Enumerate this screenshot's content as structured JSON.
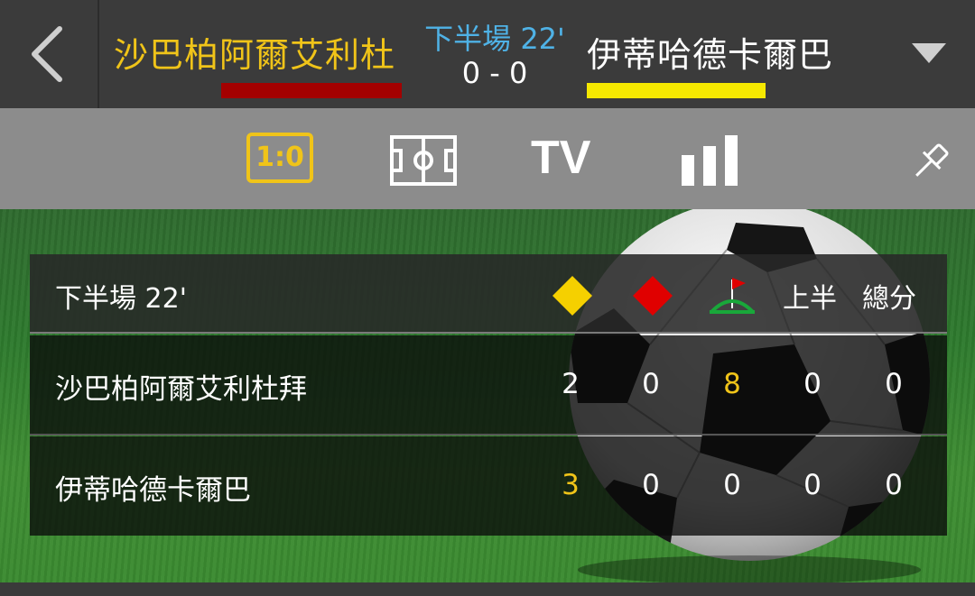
{
  "header": {
    "home_team": "沙巴柏阿爾艾利杜",
    "home_color": "#a30000",
    "away_team": "伊蒂哈德卡爾巴",
    "away_color": "#f5e800",
    "period": "下半場 22'",
    "score": "0 - 0"
  },
  "tabs": {
    "score_label": "1:0",
    "tv_label": "TV",
    "icons": [
      "scoreboard-icon",
      "field-icon",
      "tv-icon",
      "stats-icon",
      "pin-icon"
    ]
  },
  "panel": {
    "period": "下半場 22'",
    "columns": [
      "yellow-card-icon",
      "red-card-icon",
      "corner-flag-icon",
      "上半",
      "總分"
    ],
    "first_half_label": "上半",
    "total_label": "總分",
    "rows": [
      {
        "team": "沙巴柏阿爾艾利杜拜",
        "yellow": "2",
        "red": "0",
        "corners": "8",
        "first_half": "0",
        "total": "0"
      },
      {
        "team": "伊蒂哈德卡爾巴",
        "yellow": "3",
        "red": "0",
        "corners": "0",
        "first_half": "0",
        "total": "0"
      }
    ]
  },
  "colors": {
    "accent": "#f0c419",
    "period_blue": "#4fb2e6",
    "header_bg": "#3b3b3b",
    "tabbar_bg": "#8c8c8c"
  }
}
